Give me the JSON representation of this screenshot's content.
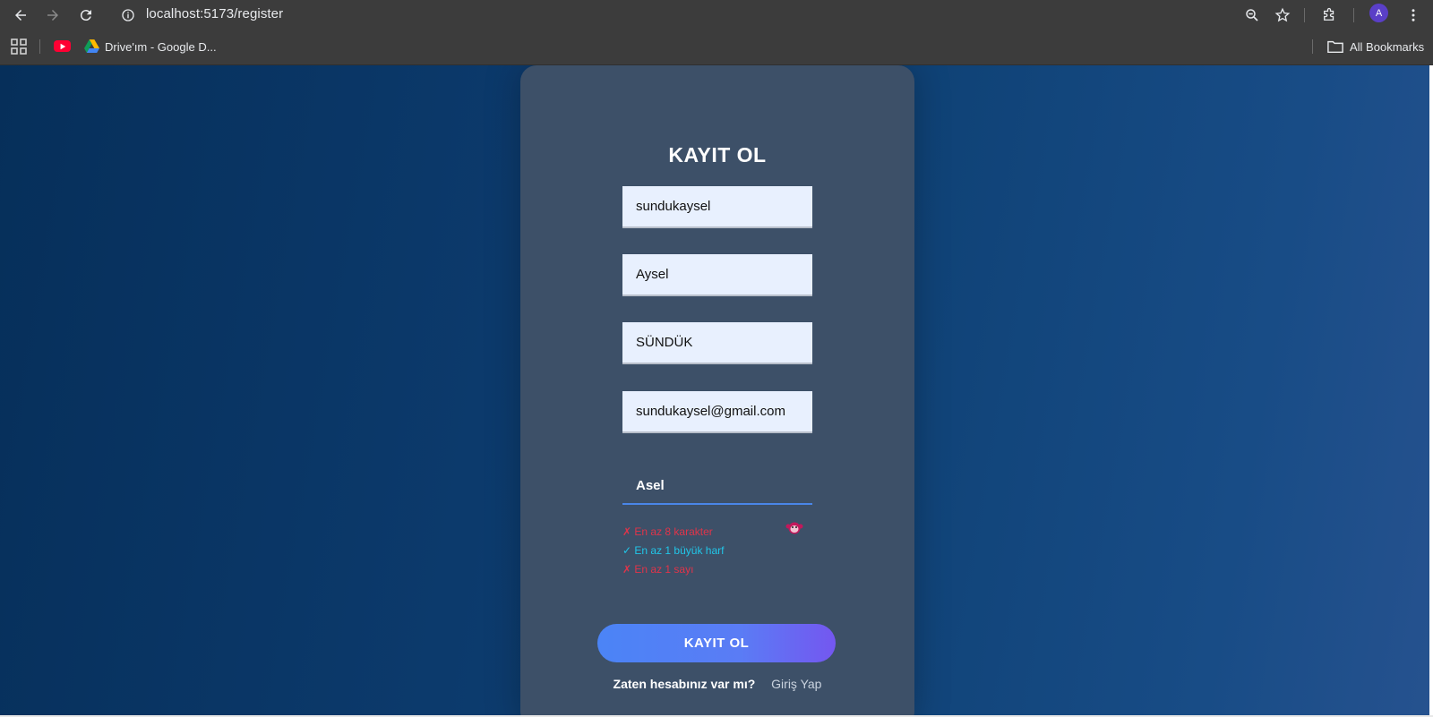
{
  "browser": {
    "url": "localhost:5173/register",
    "profile_initial": "A",
    "bookmarks": [
      {
        "icon": "youtube-icon",
        "label": ""
      },
      {
        "icon": "google-drive-icon",
        "label": "Drive'ım - Google D..."
      }
    ],
    "all_bookmarks_label": "All Bookmarks"
  },
  "form": {
    "title": "KAYIT OL",
    "fields": {
      "username": "sundukaysel",
      "first_name": "Aysel",
      "last_name": "SÜNDÜK",
      "email": "sundukaysel@gmail.com",
      "password": "Asel"
    },
    "password_rules": [
      {
        "status": "fail",
        "text": "✗ En az 8 karakter"
      },
      {
        "status": "pass",
        "text": "✓ En az 1 büyük harf"
      },
      {
        "status": "fail",
        "text": "✗ En az 1 sayı"
      }
    ],
    "submit_label": "KAYIT OL",
    "footer_question": "Zaten hesabınız var mı?",
    "footer_link": "Giriş Yap"
  },
  "colors": {
    "card_bg": "#3d5068",
    "fail": "#e0344a",
    "pass": "#21c6e8",
    "button_start": "#4b84f6",
    "button_end": "#7457f0"
  }
}
